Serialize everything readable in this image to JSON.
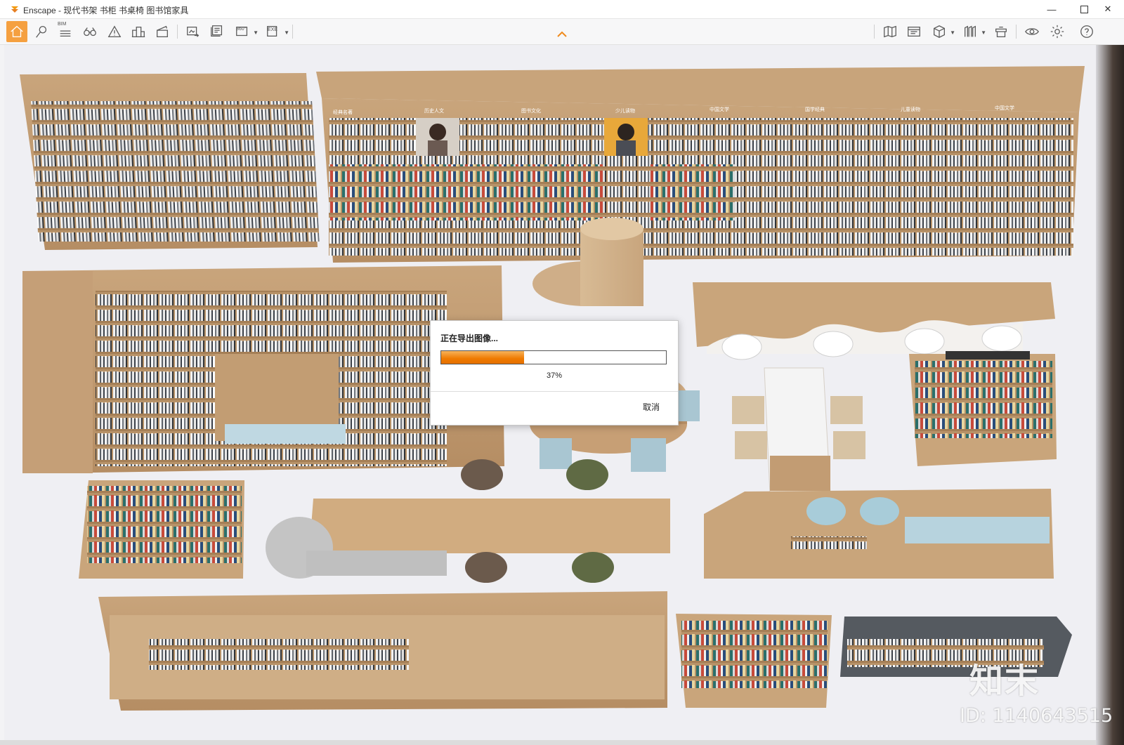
{
  "window": {
    "title": "Enscape - 现代书架 书柜 书桌椅 图书馆家具",
    "minimize_icon": "minimize-icon",
    "maximize_icon": "maximize-icon",
    "close_icon": "close-icon"
  },
  "toolbar": {
    "left_tools": [
      "home-icon",
      "location-pin-icon",
      "bim-icon",
      "binoculars-icon",
      "warning-icon",
      "buildings-icon",
      "clapperboard-icon",
      "screenshot-export-icon",
      "batch-export-icon",
      "panorama-360-icon",
      "exe-export-icon"
    ],
    "bim_label": "BIM",
    "panorama_label": "360°",
    "exe_label": "EXE",
    "right_tools": [
      "map-icon",
      "video-editor-icon",
      "cube-icon",
      "material-icon",
      "asset-library-icon",
      "visibility-icon",
      "settings-icon",
      "help-icon"
    ],
    "accent_color": "#f5a040"
  },
  "scene": {
    "shelf_sign_labels": [
      "经典名著",
      "历史人文",
      "图书文化",
      "少儿读物",
      "中国文学",
      "国学经典",
      "儿童读物",
      "中国文学"
    ]
  },
  "dialog": {
    "title": "正在导出图像...",
    "progress_fraction": 0.37,
    "progress_text": "37%",
    "cancel_label": "取消",
    "progress_color": "#ef7a00"
  },
  "watermark": {
    "logo_text": "知末",
    "id_text": "ID: 1140643515"
  }
}
